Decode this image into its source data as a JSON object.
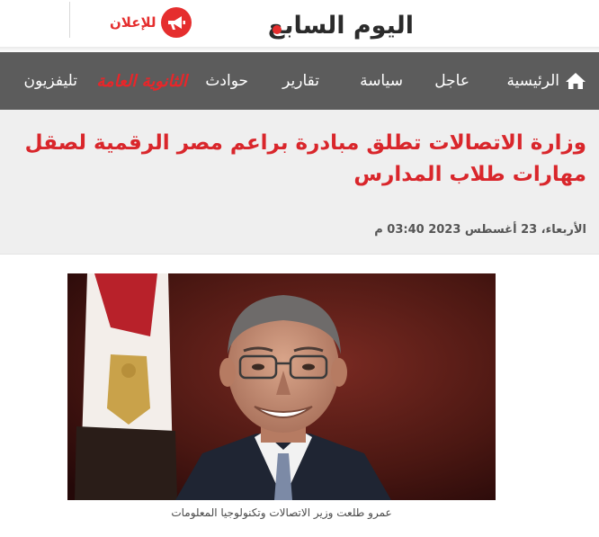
{
  "header": {
    "logo_text": "اليوم السابع",
    "ad_label": "للإعلان",
    "ad_icon": "megaphone-icon"
  },
  "nav": {
    "items": [
      {
        "label": "الرئيسية",
        "icon": "home-icon"
      },
      {
        "label": "عاجل"
      },
      {
        "label": "سياسة"
      },
      {
        "label": "تقارير"
      },
      {
        "label": "حوادث"
      },
      {
        "label": "الثانوية العامة",
        "highlight": true
      },
      {
        "label": "تليفزيون"
      }
    ]
  },
  "article": {
    "headline": "وزارة الاتصالات تطلق مبادرة براعم مصر الرقمية لصقل مهارات طلاب المدارس",
    "date": "الأربعاء، 23 أغسطس 2023 03:40 م",
    "image_caption": "عمرو طلعت وزير الاتصالات وتكنولوجيا المعلومات"
  },
  "colors": {
    "brand_red": "#d9262b",
    "nav_bg": "#5c5c5c",
    "article_bg": "#efefef"
  }
}
